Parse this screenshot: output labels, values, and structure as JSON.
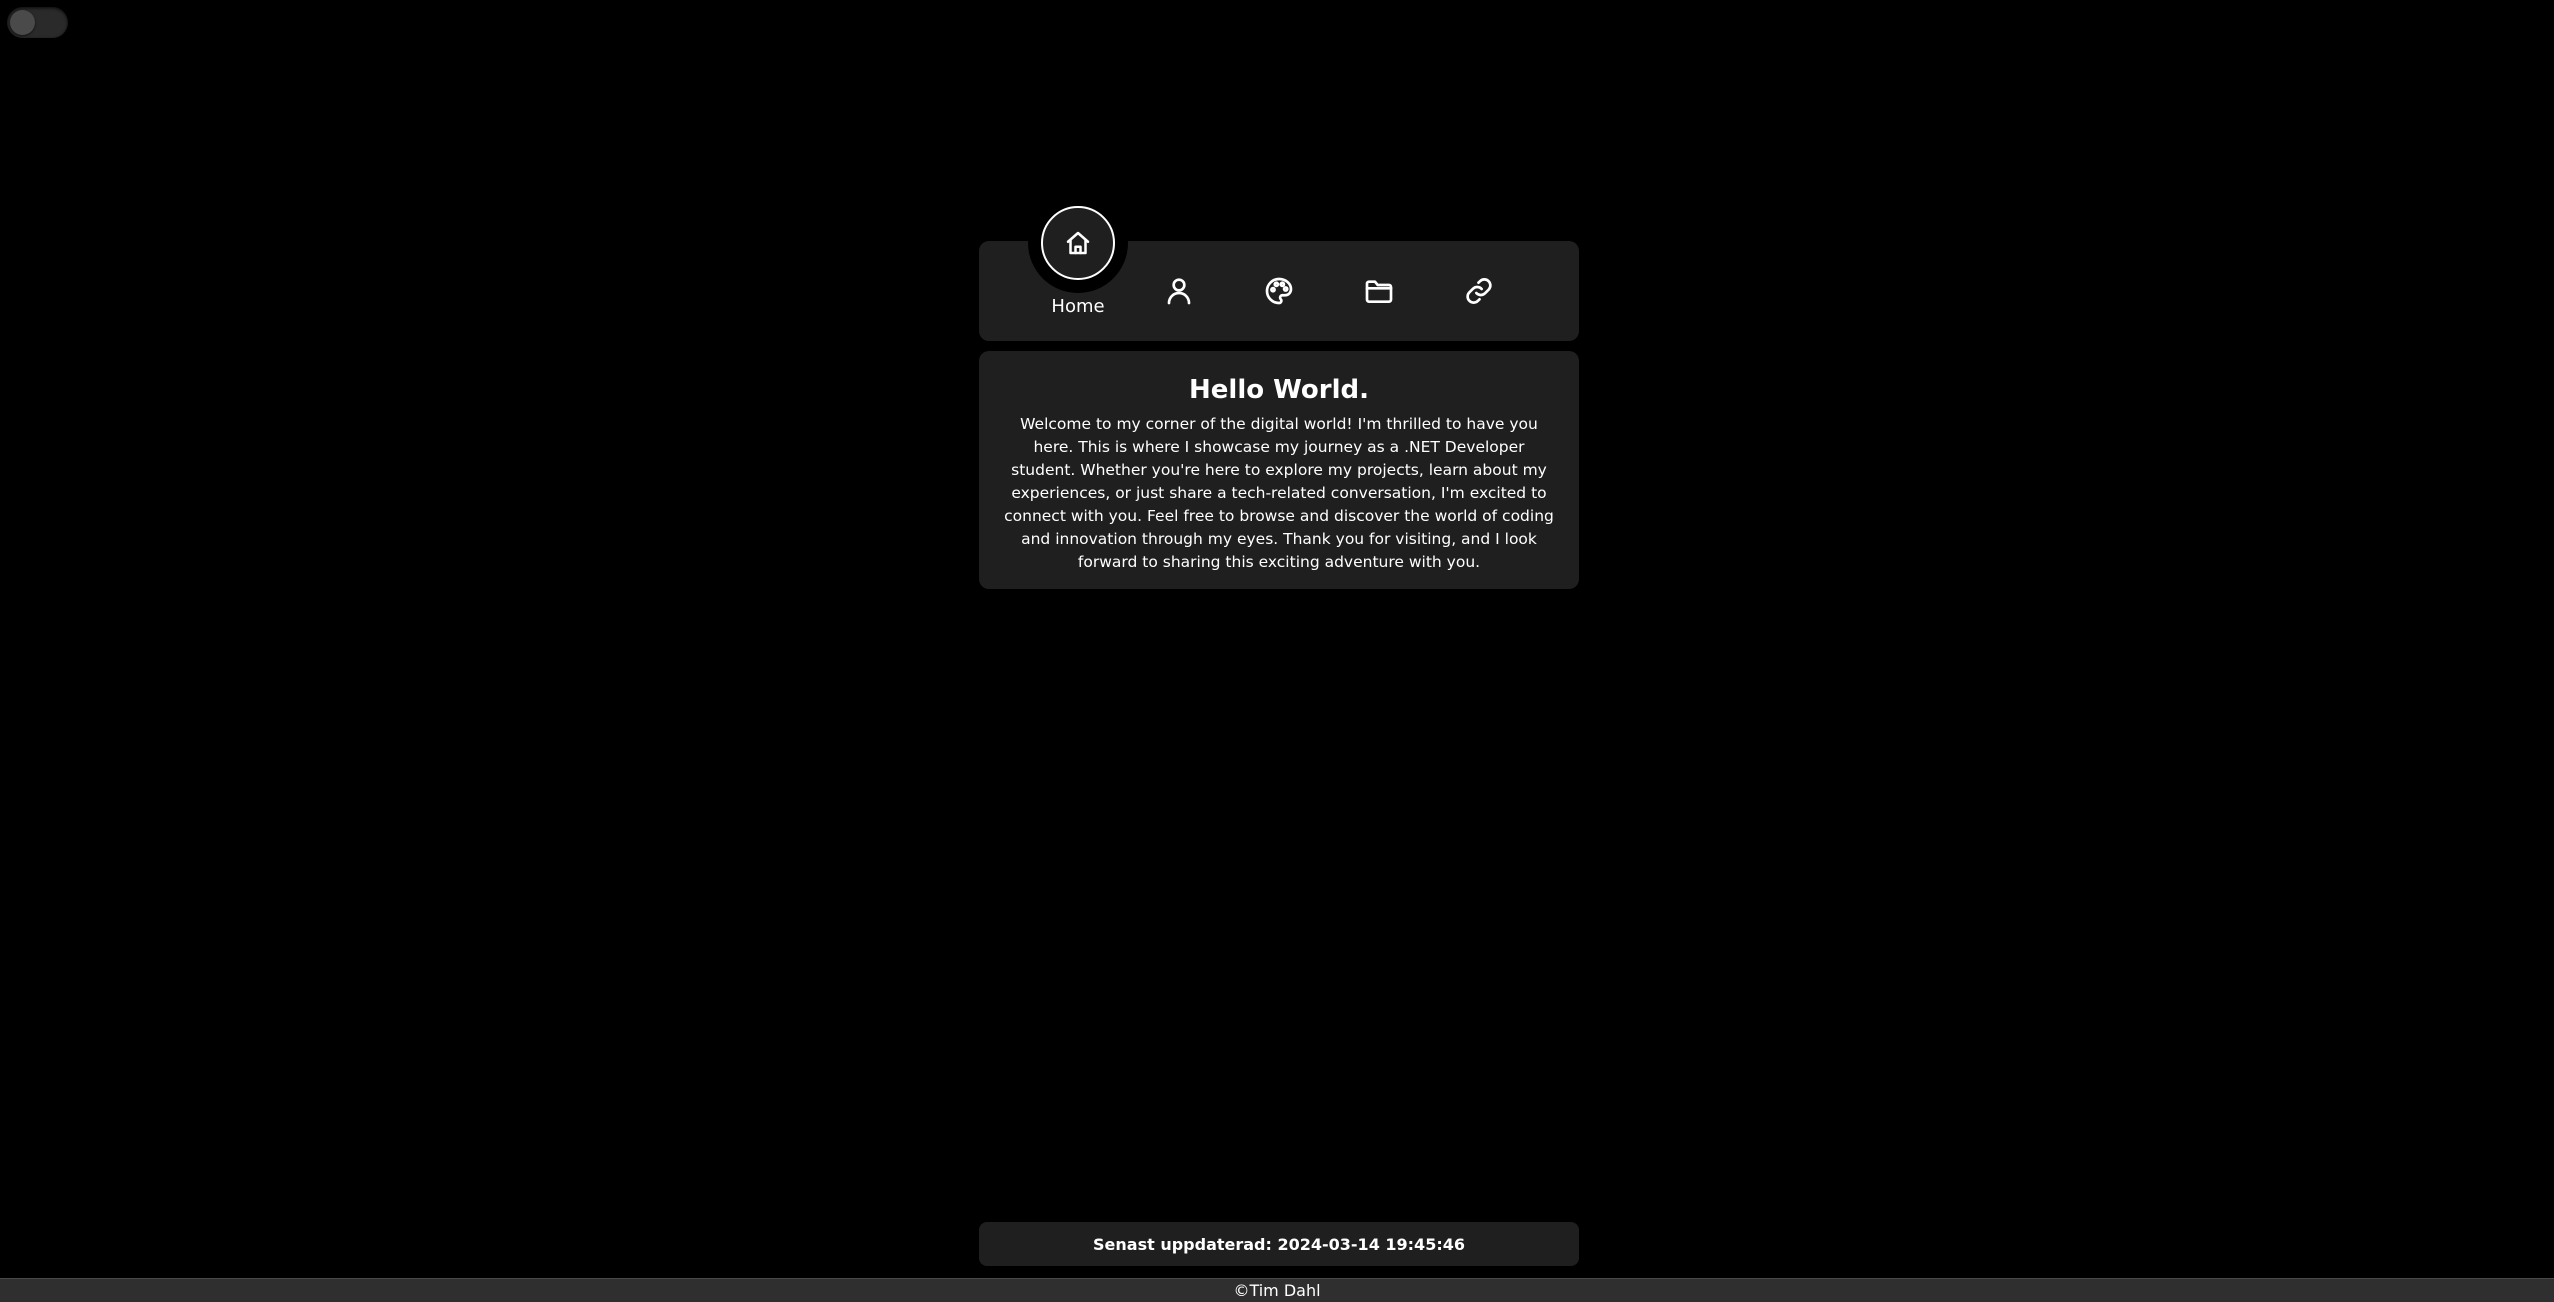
{
  "toggle": {
    "state": "off"
  },
  "nav": {
    "items": [
      {
        "id": "home",
        "label": "Home",
        "icon": "home-icon",
        "active": true
      },
      {
        "id": "about",
        "label": "",
        "icon": "user-icon",
        "active": false
      },
      {
        "id": "design",
        "label": "",
        "icon": "palette-icon",
        "active": false
      },
      {
        "id": "projects",
        "label": "",
        "icon": "folder-icon",
        "active": false
      },
      {
        "id": "links",
        "label": "",
        "icon": "link-icon",
        "active": false
      }
    ]
  },
  "content": {
    "title": "Hello World.",
    "body": "Welcome to my corner of the digital world! I'm thrilled to have you here. This is where I showcase my journey as a .NET Developer student. Whether you're here to explore my projects, learn about my experiences, or just share a tech-related conversation, I'm excited to connect with you. Feel free to browse and discover the world of coding and innovation through my eyes. Thank you for visiting, and I look forward to sharing this exciting adventure with you."
  },
  "updated": {
    "text": "Senast uppdaterad: 2024-03-14 19:45:46"
  },
  "footer": {
    "text": "©Tim Dahl"
  },
  "colors": {
    "background": "#000000",
    "panel": "#1f1f1f",
    "footer": "#2f2f2f",
    "text": "#ffffff"
  }
}
